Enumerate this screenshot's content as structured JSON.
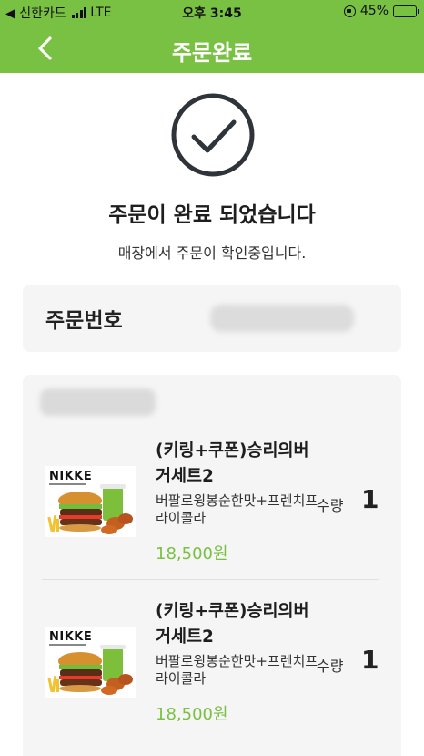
{
  "status_bar": {
    "carrier": "◀ 신한카드",
    "network": "LTE",
    "time": "오후 3:45",
    "battery": "45%",
    "battery_level": 0.45
  },
  "header": {
    "title": "주문완료"
  },
  "completion": {
    "title": "주문이 완료 되었습니다",
    "subtitle": "매장에서 주문이 확인중입니다."
  },
  "order_number": {
    "label": "주문번호",
    "value": ""
  },
  "order": {
    "store_name": "",
    "quantity_label": "수량",
    "items": [
      {
        "name": "(키링+쿠폰)승리의버거세트2",
        "description": "버팔로윙봉순한맛+프렌치프라이콜라",
        "price": "18,500원",
        "quantity": "1",
        "image_brand": "NIKKE"
      },
      {
        "name": "(키링+쿠폰)승리의버거세트2",
        "description": "버팔로윙봉순한맛+프렌치프라이콜라",
        "price": "18,500원",
        "quantity": "1",
        "image_brand": "NIKKE"
      }
    ]
  },
  "colors": {
    "brand_green": "#79c143",
    "card_background": "#f5f5f5"
  }
}
